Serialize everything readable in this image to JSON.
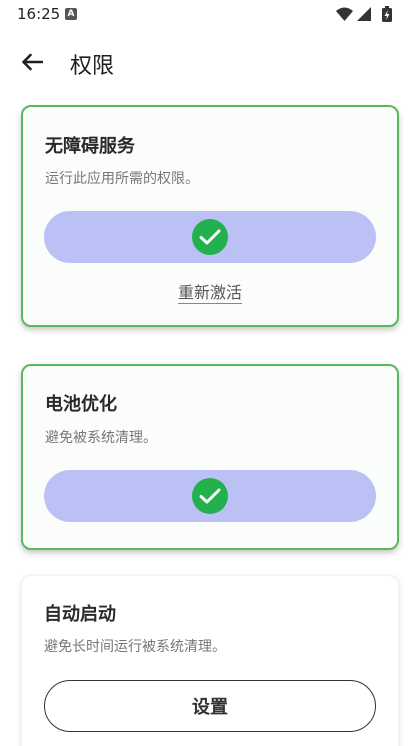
{
  "status_bar": {
    "time": "16:25",
    "notification_badge": "A",
    "icons": [
      "wifi-icon",
      "signal-icon",
      "battery-icon"
    ]
  },
  "app_bar": {
    "title": "权限",
    "back_icon": "arrow-left-icon"
  },
  "cards": {
    "accessibility": {
      "title": "无障碍服务",
      "description": "运行此应用所需的权限。",
      "status_icon": "check-icon",
      "link_label": "重新激活",
      "granted": true
    },
    "battery": {
      "title": "电池优化",
      "description": "避免被系统清理。",
      "status_icon": "check-icon",
      "granted": true
    },
    "autostart": {
      "title": "自动启动",
      "description": "避免长时间运行被系统清理。",
      "button_label": "设置"
    }
  },
  "colors": {
    "granted_border": "#5cb85c",
    "pill_fill": "#bcc1f5",
    "check_fill": "#23b14d"
  }
}
